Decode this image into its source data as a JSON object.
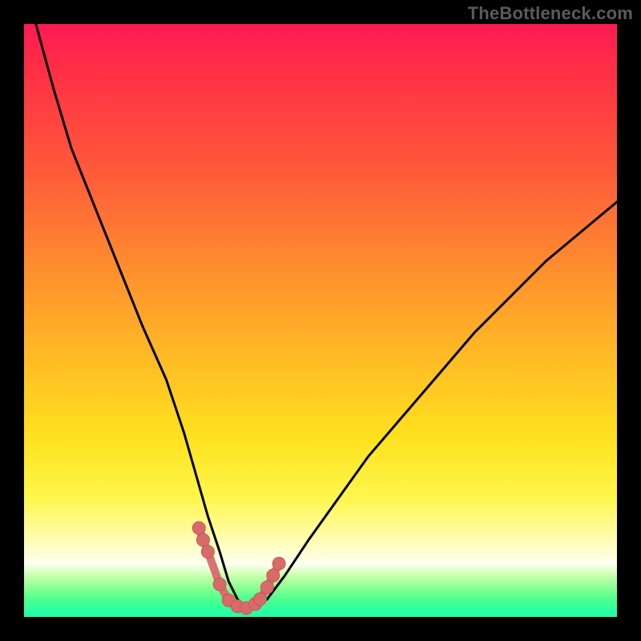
{
  "watermark": "TheBottleneck.com",
  "colors": {
    "curve_stroke": "#000000",
    "marker_fill": "#d86a6a",
    "marker_stroke": "#c85858"
  },
  "chart_data": {
    "type": "line",
    "title": "",
    "xlabel": "",
    "ylabel": "",
    "xlim": [
      0,
      100
    ],
    "ylim": [
      0,
      100
    ],
    "x": [
      2,
      5,
      8,
      12,
      16,
      20,
      24,
      27,
      29,
      31,
      33,
      34.5,
      36,
      37.5,
      39,
      41,
      44,
      48,
      53,
      58,
      64,
      70,
      76,
      82,
      88,
      94,
      100
    ],
    "y": [
      100,
      89,
      79,
      69,
      59,
      49,
      40,
      31,
      24,
      17,
      11,
      6,
      3,
      1.5,
      1.5,
      3,
      7,
      13,
      20,
      27,
      34,
      41,
      48,
      54,
      60,
      65,
      70
    ],
    "markers": {
      "x": [
        29.5,
        30.2,
        31.0,
        33.0,
        34.5,
        36.0,
        37.5,
        39.0,
        39.8,
        41.0,
        42.0,
        43.0
      ],
      "y": [
        15.0,
        13.0,
        11.0,
        5.5,
        2.8,
        1.8,
        1.5,
        2.2,
        3.0,
        5.0,
        7.0,
        9.0
      ]
    }
  }
}
